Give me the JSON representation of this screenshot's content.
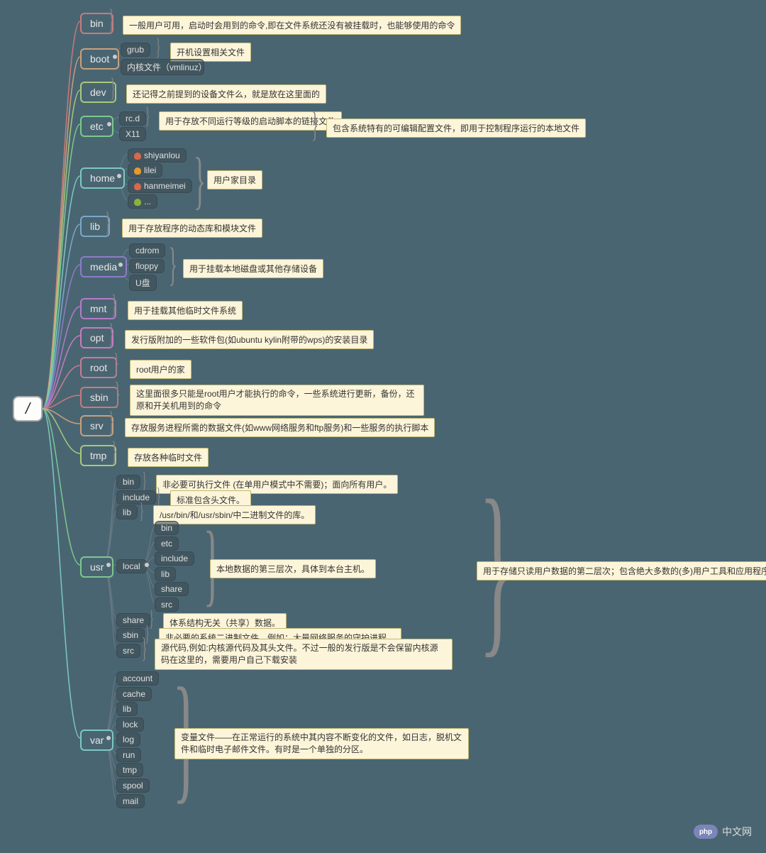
{
  "root": "/",
  "watermark": "中文网",
  "wm_logo": "php",
  "nodes": {
    "bin": {
      "label": "bin",
      "desc": "一般用户可用，启动时会用到的命令,即在文件系统还没有被挂载时，也能够使用的命令"
    },
    "boot": {
      "label": "boot",
      "children": {
        "grub": "grub",
        "kernel": "内核文件（vmlinuz）"
      },
      "grub_desc": "开机设置相关文件"
    },
    "dev": {
      "label": "dev",
      "desc": "还记得之前提到的设备文件么，就是放在这里面的"
    },
    "etc": {
      "label": "etc",
      "children": {
        "rcd": "rc.d",
        "x11": "X11"
      },
      "rcd_desc": "用于存放不同运行等级的启动脚本的链接文件",
      "desc": "包含系统特有的可编辑配置文件，即用于控制程序运行的本地文件"
    },
    "home": {
      "label": "home",
      "users": [
        "shiyanlou",
        "lilei",
        "hanmeimei",
        "..."
      ],
      "desc": "用户家目录"
    },
    "lib": {
      "label": "lib",
      "desc": "用于存放程序的动态库和模块文件"
    },
    "media": {
      "label": "media",
      "children": [
        "cdrom",
        "floppy",
        "U盘"
      ],
      "desc": "用于挂载本地磁盘或其他存储设备"
    },
    "mnt": {
      "label": "mnt",
      "desc": "用于挂载其他临时文件系统"
    },
    "opt": {
      "label": "opt",
      "desc": "发行版附加的一些软件包(如ubuntu kylin附带的wps)的安装目录"
    },
    "root": {
      "label": "root",
      "desc": "root用户的家"
    },
    "sbin": {
      "label": "sbin",
      "desc": "这里面很多只能是root用户才能执行的命令，一些系统进行更新，备份，还原和开关机用到的命令"
    },
    "srv": {
      "label": "srv",
      "desc": "存放服务进程所需的数据文件(如www网络服务和ftp服务)和一些服务的执行脚本"
    },
    "tmp": {
      "label": "tmp",
      "desc": "存放各种临时文件"
    },
    "usr": {
      "label": "usr",
      "desc": "用于存储只读用户数据的第二层次；包含绝大多数的(多)用户工具和应用程序",
      "children": {
        "bin": {
          "label": "bin",
          "desc": "非必要可执行文件 (在单用户模式中不需要)；面向所有用户。"
        },
        "include": {
          "label": "include",
          "desc": "标准包含头文件。"
        },
        "lib": {
          "label": "lib",
          "desc": "/usr/bin/和/usr/sbin/中二进制文件的库。"
        },
        "local": {
          "label": "local",
          "children": [
            "bin",
            "etc",
            "include",
            "lib",
            "share",
            "src"
          ],
          "desc": "本地数据的第三层次，具体到本台主机。"
        },
        "share": {
          "label": "share",
          "desc": "体系结构无关（共享）数据。"
        },
        "sbin": {
          "label": "sbin",
          "desc": "非必要的系统二进制文件，例如：大量网络服务的守护进程。"
        },
        "src": {
          "label": "src",
          "desc": "源代码,例如:内核源代码及其头文件。不过一般的发行版是不会保留内核源码在这里的，需要用户自己下载安装"
        }
      }
    },
    "var": {
      "label": "var",
      "children": [
        "account",
        "cache",
        "lib",
        "lock",
        "log",
        "run",
        "tmp",
        "spool",
        "mail"
      ],
      "desc": "变量文件——在正常运行的系统中其内容不断变化的文件，如日志，脱机文件和临时电子邮件文件。有时是一个单独的分区。"
    }
  },
  "user_colors": [
    "#d9684c",
    "#e69a2e",
    "#d9684c",
    "#8ab33a"
  ]
}
